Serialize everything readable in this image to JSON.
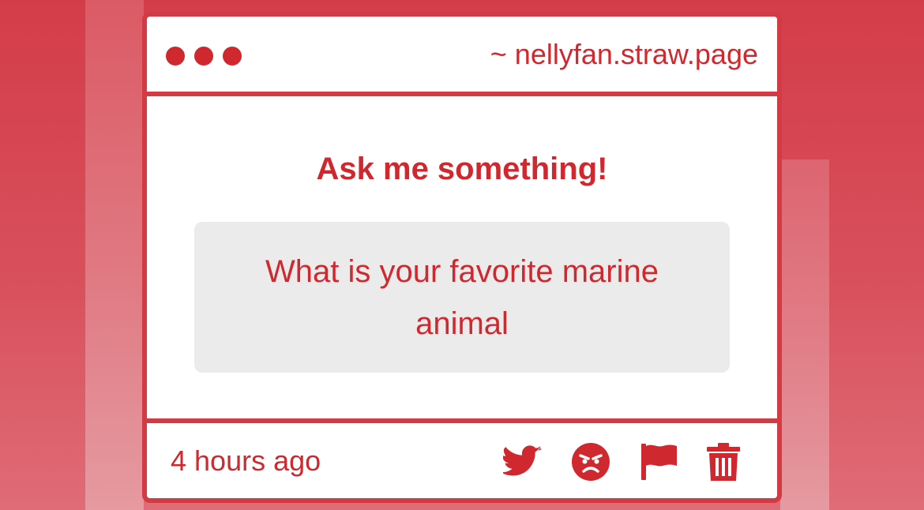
{
  "window": {
    "url": "~ nellyfan.straw.page"
  },
  "prompt": {
    "title": "Ask me something!",
    "question": "What is your favorite marine animal"
  },
  "footer": {
    "timestamp": "4 hours ago",
    "actions": [
      {
        "icon": "twitter-icon"
      },
      {
        "icon": "angry-face-icon"
      },
      {
        "icon": "flag-icon"
      },
      {
        "icon": "trash-icon"
      }
    ]
  },
  "colors": {
    "accent": "#d0282f",
    "frame": "#d23a44",
    "question_bg": "#ebebec",
    "background": "#d8505c"
  }
}
